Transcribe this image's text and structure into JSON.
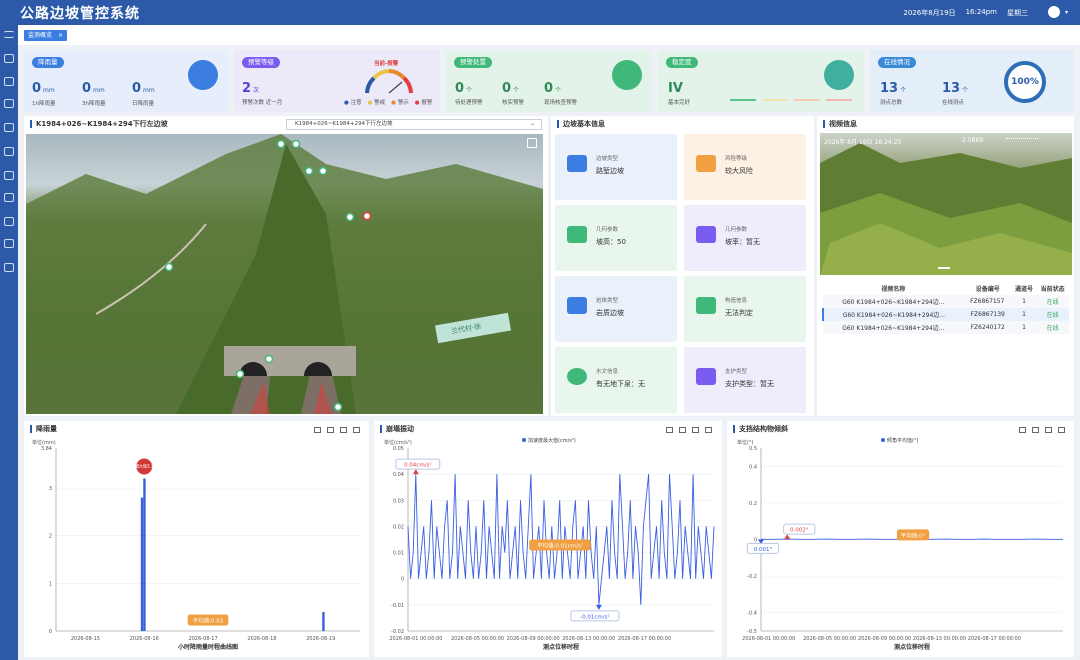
{
  "header": {
    "title": "公路边坡管控系统",
    "date": "2026年8月19日",
    "time": "16:24pm",
    "weekday": "星期三"
  },
  "tabs": [
    {
      "label": "监测概览",
      "close": "×"
    }
  ],
  "cards": {
    "rain": {
      "title": "降雨量",
      "items": [
        {
          "value": "0",
          "unit": "mm",
          "label": "1h降雨量"
        },
        {
          "value": "0",
          "unit": "mm",
          "label": "3h降雨量"
        },
        {
          "value": "0",
          "unit": "mm",
          "label": "日降雨量"
        }
      ]
    },
    "warn_level": {
      "title": "预警等级",
      "value": "2",
      "unit": "次",
      "label": "预警次数",
      "label2": "近一月",
      "gauge_label": "当前-报警",
      "legend": [
        "注意",
        "警戒",
        "警示",
        "报警"
      ],
      "legend_colors": [
        "#2c5aa8",
        "#e8c44a",
        "#e88a2c",
        "#e04040"
      ]
    },
    "warn_handle": {
      "title": "预警处置",
      "items": [
        {
          "value": "0",
          "unit": "个",
          "label": "待处理预警"
        },
        {
          "value": "0",
          "unit": "个",
          "label": "核实预警"
        },
        {
          "value": "0",
          "unit": "个",
          "label": "现场核查预警"
        }
      ]
    },
    "stability": {
      "title": "稳定度",
      "value": "IV",
      "label": "基本完好",
      "bar_colors": [
        "#5cc48a",
        "#f2e6b0",
        "#f6c9b3",
        "#f3b5b5"
      ]
    },
    "online": {
      "title": "在线情况",
      "items": [
        {
          "value": "13",
          "unit": "个",
          "label": "测点总数"
        },
        {
          "value": "13",
          "unit": "个",
          "label": "在线测点"
        }
      ],
      "percent": "100%"
    }
  },
  "slope_view": {
    "title": "K1984+026~K1984+294下行左边坡",
    "select": "K1984+026~K1984+294下行左边坡",
    "banner": "兰代村·徐"
  },
  "slope_info": {
    "title": "边坡基本信息",
    "items": [
      {
        "label": "边坡类型",
        "value": "路堑边坡",
        "bg": "#eaf1fb",
        "ic": "#3b7de0"
      },
      {
        "label": "风险等级",
        "value": "较大风险",
        "bg": "#fdf1e4",
        "ic": "#f0a040"
      },
      {
        "label": "几何参数",
        "value": "坡高：50",
        "bg": "#e8f6ee",
        "ic": "#3fb87a"
      },
      {
        "label": "几何参数",
        "value": "坡率：暂无",
        "bg": "#efedfb",
        "ic": "#7a5cf0"
      },
      {
        "label": "岩体类型",
        "value": "岩质边坡",
        "bg": "#eaf1fb",
        "ic": "#3b7de0"
      },
      {
        "label": "构造信息",
        "value": "无法判定",
        "bg": "#e8f6ee",
        "ic": "#3fb87a"
      },
      {
        "label": "水文信息",
        "value": "有无地下泉：无",
        "bg": "#e8f6ee",
        "ic": "#3fb87a"
      },
      {
        "label": "支护类型",
        "value": "支护类型：暂无",
        "bg": "#efedfb",
        "ic": "#7a5cf0"
      }
    ]
  },
  "video": {
    "title": "视频信息",
    "overlay_left": "2026年 8月 19日  16:24:25",
    "overlay_mid": "2.58KB",
    "columns": [
      "视频名称",
      "设备编号",
      "通道号",
      "当前状态"
    ],
    "rows": [
      {
        "name": "G60 K1984+026~K1984+294边...",
        "device": "FZ6867157",
        "channel": "1",
        "status": "在线"
      },
      {
        "name": "G60 K1984+026~K1984+294边...",
        "device": "FZ6867139",
        "channel": "1",
        "status": "在线"
      },
      {
        "name": "G60 K1984+026~K1984+294边...",
        "device": "FZ6240172",
        "channel": "1",
        "status": "在线"
      }
    ]
  },
  "chart_data": [
    {
      "type": "bar",
      "title": "降雨量",
      "ylabel": "单位(mm)",
      "xlabel": "小时降雨量时程曲线图",
      "ylim": [
        0,
        3.84
      ],
      "yticks": [
        "3.84",
        "3",
        "2",
        "1",
        "0"
      ],
      "xticks": [
        "2026-08-15",
        "2026-08-16",
        "2026-08-17",
        "2026-08-18",
        "2026-08-19"
      ],
      "x_range": [
        "2026-08-14T12:00",
        "2026-08-19T16:00"
      ],
      "bars": [
        {
          "x": "2026-08-15T23:00",
          "y": 2.8
        },
        {
          "x": "2026-08-16T00:00",
          "y": 3.2
        },
        {
          "x": "2026-08-19T01:00",
          "y": 0.4
        }
      ],
      "max_label": "最大值3.2",
      "avg_label": "平均值:0.03",
      "color": "#3b5fe0"
    },
    {
      "type": "line",
      "title": "崩塌振动",
      "ylabel": "单位(cm/s²)",
      "legend": "加速度最大值(cm/s²)",
      "xlabel": "测点位移时程",
      "ylim": [
        -0.02,
        0.05
      ],
      "yticks": [
        "0.05",
        "0.04",
        "0.03",
        "0.02",
        "0.01",
        "0",
        "-0.01",
        "-0.02"
      ],
      "xticks": [
        "2026-08-01 00:00:00",
        "2026-08-05 00:00:00",
        "2026-08-09 00:00:00",
        "2026-08-13 00:00:00",
        "2026-08-17 00:00:00"
      ],
      "values": [
        0.02,
        0,
        0.01,
        0.04,
        0,
        0.01,
        0.02,
        0,
        0.01,
        0.03,
        0,
        0.02,
        0.01,
        0,
        0.02,
        0.03,
        0,
        0.01,
        0.04,
        0,
        0.02,
        0.01,
        0,
        0.03,
        0.01,
        0,
        0.02,
        0,
        0.01,
        0.03,
        0,
        0.02,
        0.01,
        0,
        0.04,
        0,
        0.02,
        0.01,
        0.03,
        0,
        0.01,
        0.02,
        0,
        0.03,
        0.01,
        0,
        0.02,
        0.04,
        0,
        0.01,
        0.02,
        0,
        0.03,
        0.01,
        0,
        0.02,
        0,
        0.01,
        0.03,
        0,
        0.02,
        0.01,
        0,
        0.02,
        0.03,
        0,
        0.01,
        0.02,
        0,
        0.03,
        0.01,
        0,
        0.02,
        -0.01,
        0,
        0.01,
        0.02,
        0,
        0.03,
        0.01,
        0,
        0.04,
        0.02,
        0,
        0.01,
        0.03,
        0,
        0.02,
        0.01,
        -0.01,
        0.02,
        0.03,
        0.04,
        0,
        0.01,
        0.02,
        0,
        0.03,
        0.01,
        0,
        0.04,
        0.02,
        0,
        0.01,
        0.03,
        0,
        0.02,
        0.01,
        0,
        0.04,
        0,
        0.02,
        0.01,
        0,
        0.02,
        0.01,
        0,
        0.02
      ],
      "max_label": "0.04cm/s²",
      "min_label": "-0.01cm/s²",
      "avg_label": "平均值:0.01cm/s²",
      "color": "#3b5fe0"
    },
    {
      "type": "line",
      "title": "支挡结构物倾斜",
      "ylabel": "单位(°)",
      "legend": "倾角平均值(°)",
      "xlabel": "测点位移时程",
      "ylim": [
        -0.5,
        0.5
      ],
      "yticks": [
        "0.5",
        "0.4",
        "0.2",
        "0",
        "-0.2",
        "-0.4",
        "-0.5"
      ],
      "xticks": [
        "2026-08-01 00:00:00",
        "2026-08-05 00:00:00",
        "2026-08-09 00:00:00",
        "2026-08-13 00:00:00",
        "2026-08-17 00:00:00"
      ],
      "values": [
        0.001,
        0.001,
        0.002,
        0.001,
        0.001,
        0.002,
        0.001,
        0.001,
        0.002,
        0.001,
        0.001,
        0.002,
        0.001,
        0.001,
        0.002,
        0.001,
        0.001,
        0.002,
        0.001,
        0.001,
        0.001,
        0.002,
        0.001,
        0.001
      ],
      "max_label": "0.002°",
      "min_label": "0.001°",
      "avg_label": "平均值:0°",
      "color": "#3b5fe0"
    }
  ]
}
